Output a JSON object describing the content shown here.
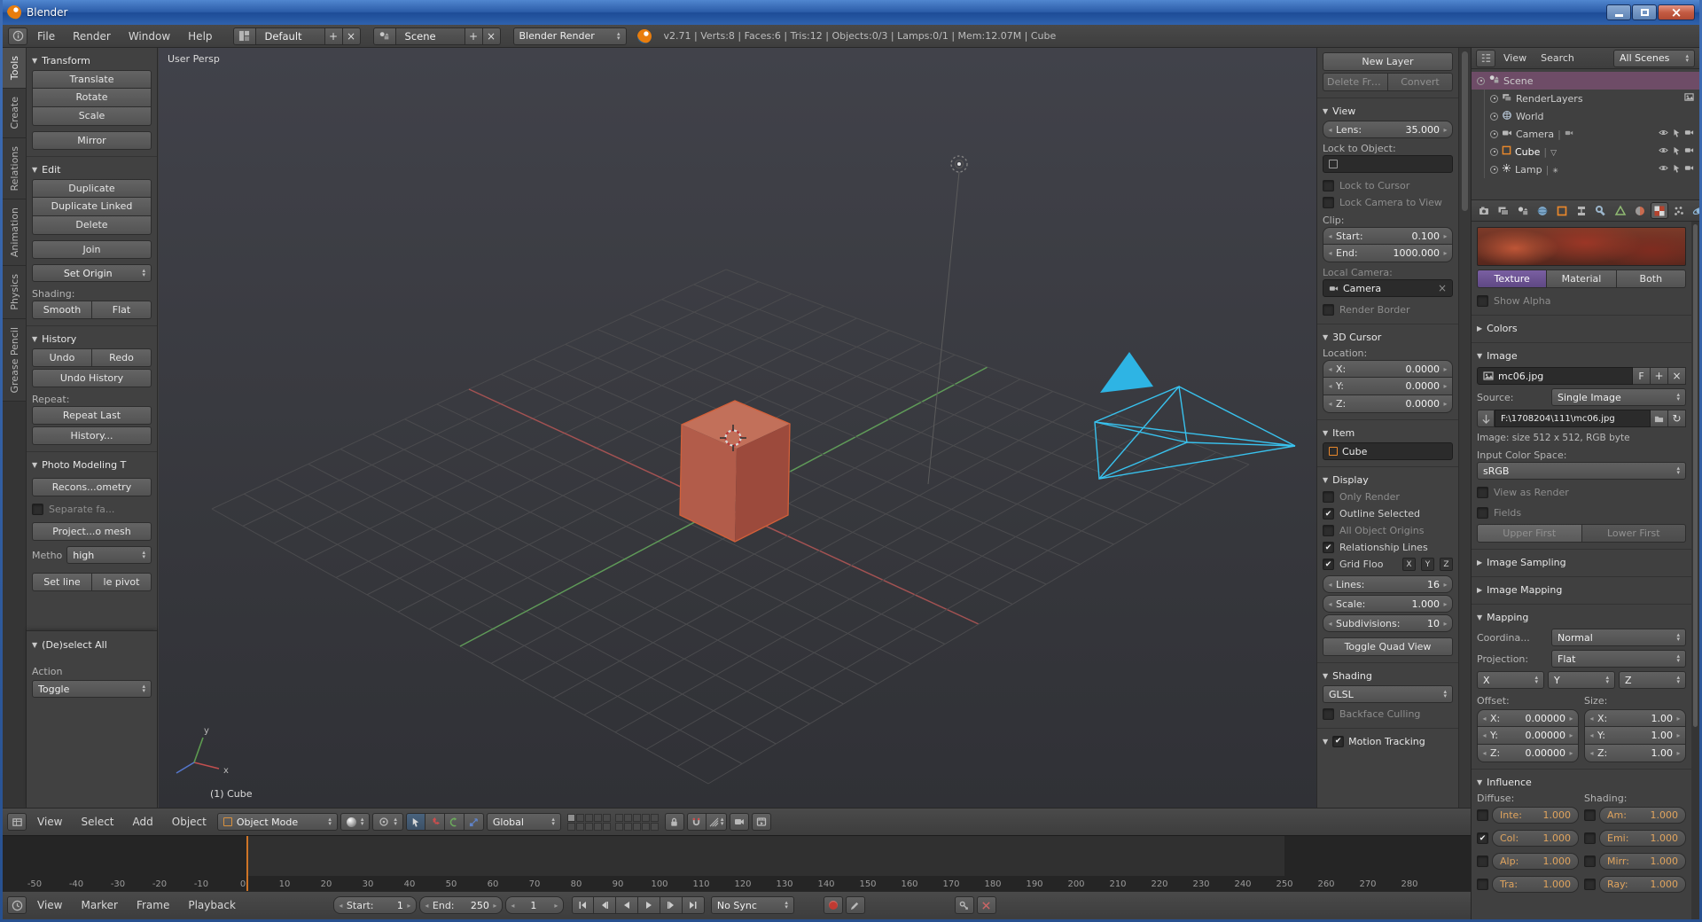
{
  "win": {
    "title": "Blender"
  },
  "top": {
    "m0": "File",
    "m1": "Render",
    "m2": "Window",
    "m3": "Help",
    "layout": "Default",
    "scene": "Scene",
    "engine": "Blender Render",
    "stats": "v2.71 | Verts:8 | Faces:6 | Tris:12 | Objects:0/3 | Lamps:0/1 | Mem:12.07M | Cube"
  },
  "tabs": [
    "Tools",
    "Create",
    "Relations",
    "Animation",
    "Physics",
    "Grease Pencil"
  ],
  "ts": {
    "transform": "Transform",
    "translate": "Translate",
    "rotate": "Rotate",
    "scale": "Scale",
    "mirror": "Mirror",
    "edit": "Edit",
    "duplicate": "Duplicate",
    "dup_linked": "Duplicate Linked",
    "del": "Delete",
    "join": "Join",
    "set_origin": "Set Origin",
    "shading": "Shading:",
    "smooth": "Smooth",
    "flat": "Flat",
    "history": "History",
    "undo": "Undo",
    "redo": "Redo",
    "undo_history": "Undo History",
    "repeat": "Repeat:",
    "repeat_last": "Repeat Last",
    "history_menu": "History...",
    "photo": "Photo Modeling T",
    "recons": "Recons...ometry",
    "separate": "Separate fa...",
    "project": "Project...o mesh",
    "metho": "Metho",
    "high": "high",
    "set_line1": "Set line",
    "set_line2": "le pivot",
    "deselect": "(De)select All",
    "action": "Action",
    "toggle": "Toggle"
  },
  "vp": {
    "persp": "User Persp",
    "obj": "(1) Cube",
    "ax": "x",
    "ay": "y"
  },
  "vph": {
    "m0": "View",
    "m1": "Select",
    "m2": "Add",
    "m3": "Object",
    "mode": "Object Mode",
    "orient": "Global"
  },
  "np": {
    "new_layer": "New Layer",
    "del_frame": "Delete Fra...",
    "convert": "Convert",
    "view": "View",
    "lens_l": "Lens:",
    "lens_v": "35.000",
    "lock_obj": "Lock to Object:",
    "lock_cursor": "Lock to Cursor",
    "lock_cam": "Lock Camera to View",
    "clip": "Clip:",
    "start_l": "Start:",
    "start_v": "0.100",
    "end_l": "End:",
    "end_v": "1000.000",
    "local_cam": "Local Camera:",
    "cam_v": "Camera",
    "render_border": "Render Border",
    "cursor3d": "3D Cursor",
    "loc": "Location:",
    "xl": "X:",
    "xv": "0.0000",
    "yl": "Y:",
    "yv": "0.0000",
    "zl": "Z:",
    "zv": "0.0000",
    "item": "Item",
    "item_name": "Cube",
    "display": "Display",
    "only_render": "Only Render",
    "outline_sel": "Outline Selected",
    "origins": "All Object Origins",
    "rel_lines": "Relationship Lines",
    "grid_floor": "Grid Floo",
    "gx": "X",
    "gy": "Y",
    "gz": "Z",
    "lines_l": "Lines:",
    "lines_v": "16",
    "scale_l": "Scale:",
    "scale_v": "1.000",
    "subd_l": "Subdivisions:",
    "subd_v": "10",
    "quad": "Toggle Quad View",
    "shading": "Shading",
    "glsl": "GLSL",
    "backface": "Backface Culling",
    "motion": "Motion Tracking"
  },
  "ol": {
    "view": "View",
    "search": "Search",
    "scenes": "All Scenes",
    "r0": "Scene",
    "r1": "RenderLayers",
    "r2": "World",
    "r3": "Camera",
    "r4": "Cube",
    "r5": "Lamp"
  },
  "pr": {
    "texture": "Texture",
    "material": "Material",
    "both": "Both",
    "show_alpha": "Show Alpha",
    "colors": "Colors",
    "image": "Image",
    "img_name": "mc06.jpg",
    "fake": "F",
    "source_l": "Source:",
    "source_v": "Single Image",
    "path": "F:\\1708204\\111\\mc06.jpg",
    "info": "Image: size 512 x 512, RGB byte",
    "cspace_l": "Input Color Space:",
    "cspace_v": "sRGB",
    "view_render": "View as Render",
    "fields": "Fields",
    "upper": "Upper First",
    "lower": "Lower First",
    "img_sampling": "Image Sampling",
    "img_mapping": "Image Mapping",
    "mapping": "Mapping",
    "coord_l": "Coordina...",
    "coord_v": "Normal",
    "proj_l": "Projection:",
    "proj_v": "Flat",
    "mx": "X",
    "my": "Y",
    "mz": "Z",
    "offset": "Offset:",
    "size": "Size:",
    "ox_l": "X:",
    "ox_v": "0.00000",
    "oy_l": "Y:",
    "oy_v": "0.00000",
    "oz_l": "Z:",
    "oz_v": "0.00000",
    "sx_l": "X:",
    "sx_v": "1.00",
    "sy_l": "Y:",
    "sy_v": "1.00",
    "sz_l": "Z:",
    "sz_v": "1.00",
    "influence": "Influence",
    "diffuse": "Diffuse:",
    "shading": "Shading:",
    "inf": [
      {
        "l": "Inte:",
        "v": "1.000",
        "c": false
      },
      {
        "l": "Col:",
        "v": "1.000",
        "c": true
      },
      {
        "l": "Alp:",
        "v": "1.000",
        "c": false
      },
      {
        "l": "Tra:",
        "v": "1.000",
        "c": false
      }
    ],
    "inf2": [
      {
        "l": "Am:",
        "v": "1.000",
        "c": false
      },
      {
        "l": "Emi:",
        "v": "1.000",
        "c": false
      },
      {
        "l": "Mirr:",
        "v": "1.000",
        "c": false
      },
      {
        "l": "Ray:",
        "v": "1.000",
        "c": false
      }
    ]
  },
  "tl": {
    "ticks": [
      -50,
      -40,
      -30,
      -20,
      -10,
      0,
      10,
      20,
      30,
      40,
      50,
      60,
      70,
      80,
      90,
      100,
      110,
      120,
      130,
      140,
      150,
      160,
      170,
      180,
      190,
      200,
      210,
      220,
      230,
      240,
      250,
      260,
      270,
      280
    ],
    "m0": "View",
    "m1": "Marker",
    "m2": "Frame",
    "m3": "Playback",
    "start_l": "Start:",
    "start_v": "1",
    "end_l": "End:",
    "end_v": "250",
    "cur": "1",
    "sync": "No Sync",
    "cur_frame": 1,
    "range": [
      1,
      250
    ],
    "view_min": -50,
    "view_max": 290
  }
}
